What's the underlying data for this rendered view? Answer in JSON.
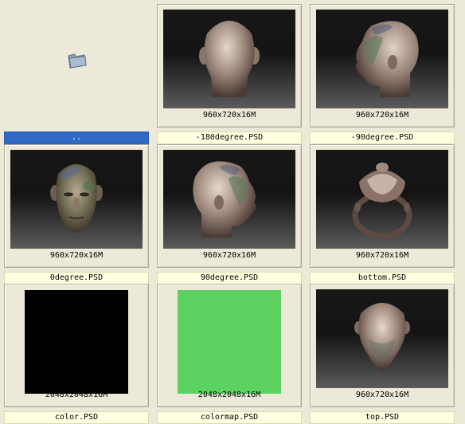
{
  "items": [
    {
      "name": "..",
      "selected": true,
      "kind": "folder",
      "icon": "folder-icon"
    },
    {
      "name": "-180degree.PSD",
      "info": "960x720x16M",
      "kind": "render",
      "view": "back"
    },
    {
      "name": "-90degree.PSD",
      "info": "960x720x16M",
      "kind": "render",
      "view": "side-left"
    },
    {
      "name": "0degree.PSD",
      "info": "960x720x16M",
      "kind": "render",
      "view": "front"
    },
    {
      "name": "90degree.PSD",
      "info": "960x720x16M",
      "kind": "render",
      "view": "side-right"
    },
    {
      "name": "bottom.PSD",
      "info": "960x720x16M",
      "kind": "render",
      "view": "bottom"
    },
    {
      "name": "color.PSD",
      "info": "2048x2048x16M",
      "kind": "swatch",
      "color": "#000000"
    },
    {
      "name": "colormap.PSD",
      "info": "2048x2048x16M",
      "kind": "swatch",
      "color": "#5bd261"
    },
    {
      "name": "top.PSD",
      "info": "960x720x16M",
      "kind": "render",
      "view": "top"
    }
  ]
}
